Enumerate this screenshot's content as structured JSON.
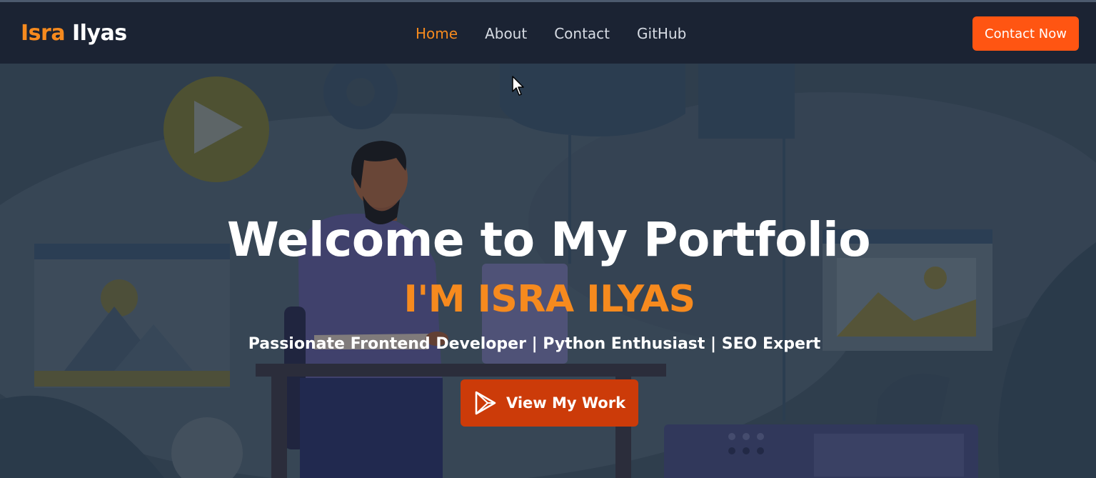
{
  "header": {
    "logo_first": "Isra",
    "logo_last": "Ilyas",
    "nav": [
      {
        "label": "Home",
        "active": true
      },
      {
        "label": "About",
        "active": false
      },
      {
        "label": "Contact",
        "active": false
      },
      {
        "label": "GitHub",
        "active": false
      }
    ],
    "contact_button": "Contact Now"
  },
  "hero": {
    "title": "Welcome to My Portfolio",
    "name": "I'M ISRA ILYAS",
    "subtitle": "Passionate Frontend Developer | Python Enthusiast | SEO Expert",
    "cta": {
      "label": "View My Work",
      "icon": "play-store-icon"
    }
  },
  "colors": {
    "accent": "#f68a1e",
    "nav_bg": "#1b2333",
    "contact_button_bg": "#ff5512",
    "cta_bg": "#cc3b09"
  }
}
